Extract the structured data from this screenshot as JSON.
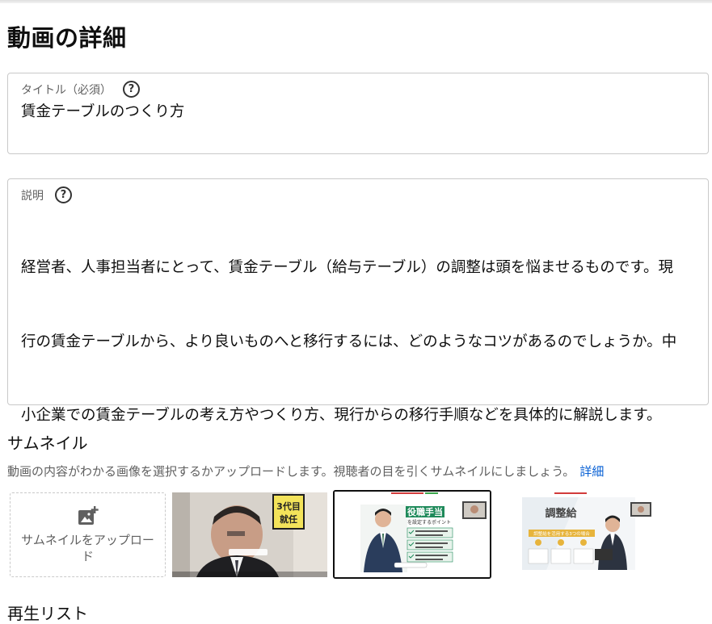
{
  "page": {
    "title": "動画の詳細"
  },
  "title_field": {
    "label": "タイトル（必須）",
    "help_icon": "?",
    "value": "賃金テーブルのつくり方"
  },
  "description_field": {
    "label": "説明",
    "help_icon": "?",
    "lines": [
      "経営者、人事担当者にとって、賃金テーブル（給与テーブル）の調整は頭を悩ませるものです。現",
      "行の賃金テーブルから、より良いものへと移行するには、どのようなコツがあるのでしょうか。中",
      "小企業での賃金テーブルの考え方やつくり方、現行からの移行手順などを具体的に解説します。"
    ]
  },
  "thumbnail": {
    "heading": "サムネイル",
    "description": "動画の内容がわかる画像を選択するかアップロードします。視聴者の目を引くサムネイルにしましょう。",
    "more_link": "詳細",
    "upload_label": "サムネイルをアップロード",
    "upload_icon": "add-photo-icon",
    "options": [
      {
        "name": "thumbnail-option-1",
        "poster_text": "3代目 就任",
        "selected": false
      },
      {
        "name": "thumbnail-option-2",
        "headline": "役職手当",
        "subline": "を設定するポイント",
        "bullets": [
          "役つく前に決めてから",
          "細かく調整する",
          "会社独自の基準に沿ってから",
          "基本給・仕事給をプラス",
          "会社の方針と重視ポイント",
          "会社の業績指標を求める"
        ],
        "selected": true
      },
      {
        "name": "thumbnail-option-3",
        "headline": "調整給",
        "subline": "調整給を活用する3つの場合",
        "labels": [
          "移動検査・組成する",
          "若手社員",
          "新卒"
        ],
        "selected": false
      }
    ]
  },
  "playlist": {
    "heading": "再生リスト"
  },
  "colors": {
    "accent_link": "#065fd4",
    "border": "#c9c9c9",
    "secondary_text": "#606060"
  }
}
